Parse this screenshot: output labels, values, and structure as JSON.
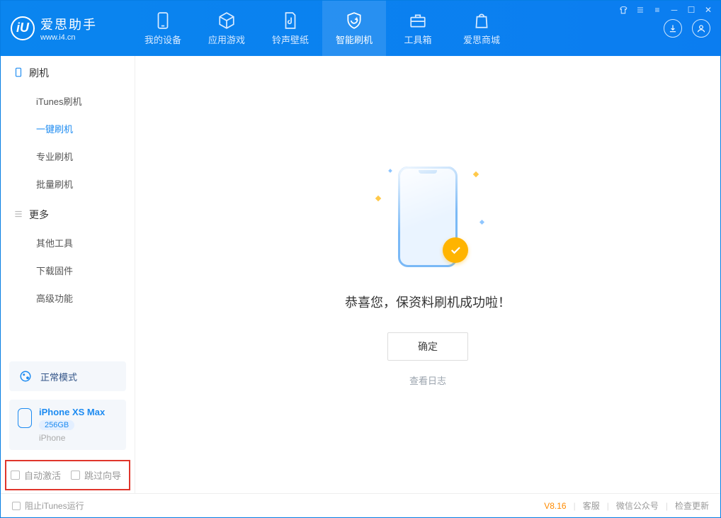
{
  "app": {
    "name": "爱思助手",
    "url": "www.i4.cn"
  },
  "nav": {
    "device": "我的设备",
    "apps": "应用游戏",
    "ring": "铃声壁纸",
    "flash": "智能刷机",
    "tools": "工具箱",
    "store": "爱思商城"
  },
  "sidebar": {
    "group_flash": "刷机",
    "items_flash": {
      "itunes": "iTunes刷机",
      "oneclick": "一键刷机",
      "pro": "专业刷机",
      "batch": "批量刷机"
    },
    "group_more": "更多",
    "items_more": {
      "other": "其他工具",
      "firmware": "下载固件",
      "advanced": "高级功能"
    },
    "mode_label": "正常模式",
    "device": {
      "name": "iPhone XS Max",
      "storage": "256GB",
      "type": "iPhone"
    },
    "opt_auto_activate": "自动激活",
    "opt_skip_guide": "跳过向导"
  },
  "main": {
    "success_msg": "恭喜您，保资料刷机成功啦！",
    "ok_btn": "确定",
    "log_link": "查看日志"
  },
  "footer": {
    "block_itunes": "阻止iTunes运行",
    "version": "V8.16",
    "support": "客服",
    "wechat": "微信公众号",
    "check_update": "检查更新"
  }
}
